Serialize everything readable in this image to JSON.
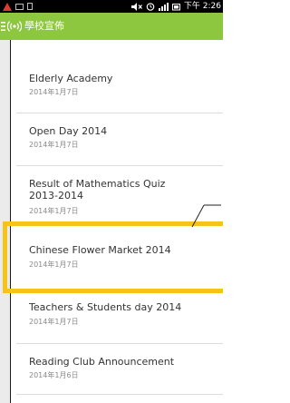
{
  "status_bar": {
    "time": "下午 2:26"
  },
  "app_bar": {
    "title": "學校宣佈"
  },
  "announcements": [
    {
      "title": "Elderly Academy",
      "date": "2014年1月7日"
    },
    {
      "title": "Open Day 2014",
      "date": "2014年1月7日"
    },
    {
      "title_line1": "Result of Mathematics Quiz",
      "title_line2": "2013-2014",
      "date": "2014年1月7日"
    },
    {
      "title": "Chinese Flower Market 2014",
      "date": "2014年1月7日"
    },
    {
      "title": "Teachers & Students day 2014",
      "date": "2014年1月7日"
    },
    {
      "title": "Reading Club Announcement",
      "date": "2014年1月6日"
    }
  ],
  "colors": {
    "app_bar": "#8dc63f",
    "highlight": "#f6c418",
    "status_bar": "#000000"
  },
  "icons": [
    "warning-icon",
    "image-icon",
    "sd-card-icon",
    "mute-icon",
    "alarm-icon",
    "signal-icon",
    "battery-icon",
    "drawer-icon",
    "broadcast-icon"
  ]
}
